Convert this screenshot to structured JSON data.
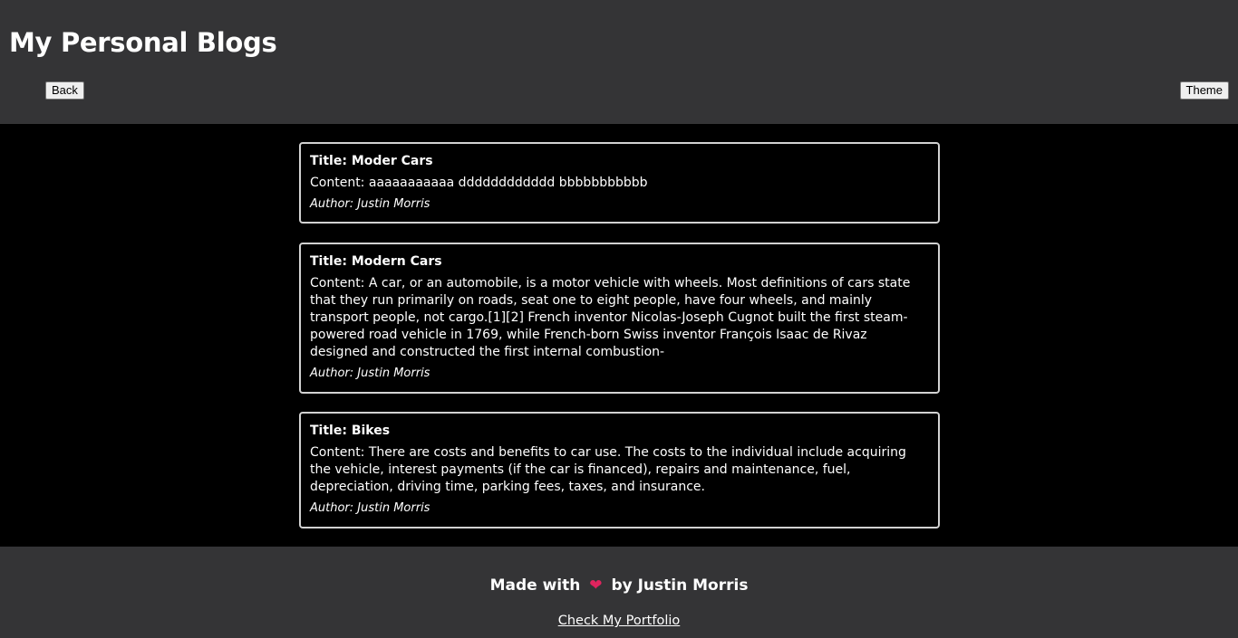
{
  "header": {
    "title": "My Personal Blogs",
    "back_label": "Back",
    "theme_label": "Theme"
  },
  "labels": {
    "title_prefix": "Title: ",
    "content_prefix": "Content: ",
    "author_prefix": "Author: "
  },
  "posts": [
    {
      "title": "Moder Cars",
      "content": "aaaaaaaaaaa dddddddddddd bbbbbbbbbbb",
      "author": "Justin Morris"
    },
    {
      "title": "Modern Cars",
      "content": "A car, or an automobile, is a motor vehicle with wheels. Most definitions of cars state that they run primarily on roads, seat one to eight people, have four wheels, and mainly transport people, not cargo.[1][2] French inventor Nicolas-Joseph Cugnot built the first steam-powered road vehicle in 1769, while French-born Swiss inventor François Isaac de Rivaz designed and constructed the first internal combustion-",
      "author": "Justin Morris"
    },
    {
      "title": "Bikes",
      "content": "There are costs and benefits to car use. The costs to the individual include acquiring the vehicle, interest payments (if the car is financed), repairs and maintenance, fuel, depreciation, driving time, parking fees, taxes, and insurance.",
      "author": "Justin Morris"
    }
  ],
  "footer": {
    "made_with": "Made with",
    "heart_icon": "heart-icon",
    "heart_glyph": "❤",
    "by_author": "by Justin Morris",
    "portfolio_link": "Check My Portfolio"
  },
  "colors": {
    "header_bg": "#343436",
    "main_bg": "#000000",
    "card_border": "#d2d2d2",
    "heart": "#e0245e"
  }
}
